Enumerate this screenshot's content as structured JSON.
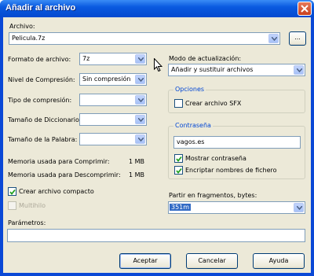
{
  "window": {
    "title": "Añadir al archivo"
  },
  "archive": {
    "label": "Archivo:",
    "value": "Pelicula.7z",
    "browse_label": "..."
  },
  "left": {
    "format_label": "Formato de archivo:",
    "format_value": "7z",
    "level_label": "Nivel de Compresión:",
    "level_value": "Sin compresión",
    "type_label": "Tipo de compresión:",
    "type_value": "",
    "dict_label": "Tamaño de Diccionario:",
    "dict_value": "",
    "word_label": "Tamaño de la Palabra:",
    "word_value": "",
    "mem_compress_label": "Memoria usada para Comprimir:",
    "mem_compress_value": "1 MB",
    "mem_decompress_label": "Memoria usada para Descomprimir:",
    "mem_decompress_value": "1 MB",
    "solid_label": "Crear archivo compacto",
    "solid_checked": true,
    "multithread_label": "Multihilo",
    "multithread_checked": false
  },
  "right": {
    "update_mode_label": "Modo de actualización:",
    "update_mode_value": "Añadir y sustituir archivos",
    "options_title": "Opciones",
    "sfx_label": "Crear archivo SFX",
    "sfx_checked": false,
    "password_title": "Contraseña",
    "password_value": "vagos.es",
    "show_password_label": "Mostrar contraseña",
    "show_password_checked": true,
    "encrypt_names_label": "Encriptar nombres de fichero",
    "encrypt_names_checked": true,
    "split_label": "Partir en fragmentos, bytes:",
    "split_value": "351m"
  },
  "params": {
    "label": "Parámetros:",
    "value": ""
  },
  "buttons": {
    "ok": "Aceptar",
    "cancel": "Cancelar",
    "help": "Ayuda"
  }
}
